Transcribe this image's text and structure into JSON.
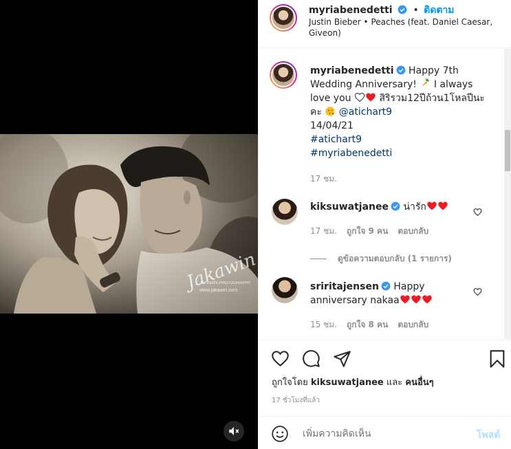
{
  "post": {
    "author": "myriabenedetti",
    "follow_sep": "•",
    "follow_label": "ติดตาม",
    "music": "Justin Bieber • Peaches (feat. Daniel Caesar, Giveon)"
  },
  "caption": {
    "username": "myriabenedetti",
    "text_line1": "Happy 7th Wedding Anniversary!",
    "text_line2a": "I always love you",
    "text_line2b": "สิริรวม12ปีถ้วน1โหลปีนะคะ",
    "mention": "@atichart9",
    "date": "14/04/21",
    "hashtag1": "#atichart9",
    "hashtag2": "#myriabenedetti",
    "time": "17 ชม."
  },
  "comments": [
    {
      "username": "kiksuwatjanee",
      "text": "น่ารัก",
      "time": "17 ชม.",
      "likes": "ถูกใจ 9 คน",
      "reply": "ตอบกลับ",
      "view_replies": "ดูข้อความตอบกลับ (1 รายการ)"
    },
    {
      "username": "sriritajensen",
      "text_line1": "Happy",
      "text_line2": "anniversary nakaa",
      "time": "15 ชม.",
      "likes": "ถูกใจ 8 คน",
      "reply": "ตอบกลับ"
    }
  ],
  "likes": {
    "prefix": "ถูกใจโดย",
    "user": "kiksuwatjanee",
    "and": "และ",
    "others": "คนอื่นๆ"
  },
  "timestamp": "17 ชั่วโมงที่แล้ว",
  "add_comment": {
    "placeholder": "เพิ่มความคิดเห็น",
    "post_label": "โพสต์"
  },
  "photo": {
    "watermark_signature": "Jakawin",
    "watermark_line1": "JAKAWIN PHOTOGRAPHY",
    "watermark_line2": "www.jakawin.com"
  },
  "colors": {
    "link": "#00376b",
    "accent": "#0095f6",
    "heart_red": "#ed1c24",
    "muted": "#8e8e8e"
  },
  "icons": [
    "verified-badge-icon",
    "heart-icon",
    "comment-icon",
    "share-icon",
    "bookmark-icon",
    "emoji-icon",
    "mute-icon",
    "carrot-emoji",
    "kiss-emoji"
  ]
}
